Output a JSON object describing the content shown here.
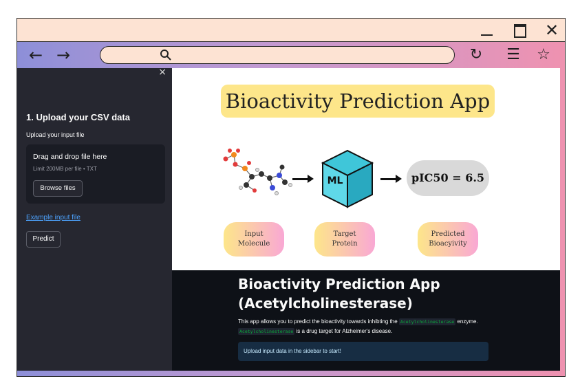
{
  "window": {
    "minimize": "−",
    "maximize": "",
    "close": "✕"
  },
  "toolbar": {
    "back": "←",
    "forward": "→",
    "reload": "↻",
    "menu": "☰",
    "bookmark": "☆"
  },
  "sidebar": {
    "close": "×",
    "heading": "1. Upload your CSV data",
    "upload_label": "Upload your input file",
    "dropzone_title": "Drag and drop file here",
    "dropzone_limit": "Limit 200MB per file • TXT",
    "browse_label": "Browse files",
    "example_link": "Example input file",
    "predict_label": "Predict"
  },
  "banner": {
    "title": "Bioactivity Prediction App",
    "model_label": "ML",
    "result": "pIC50 = 6.5",
    "pills": [
      {
        "line1": "Input",
        "line2": "Molecule"
      },
      {
        "line1": "Target",
        "line2": "Protein"
      },
      {
        "line1": "Predicted",
        "line2": "Bioacyivity"
      }
    ]
  },
  "main": {
    "title_line1": "Bioactivity Prediction App",
    "title_line2": "(Acetylcholinesterase)",
    "desc_prefix": "This app allows you to predict the bioactivity towards inhibting the",
    "desc_code": "Acetylcholinesterase",
    "desc_suffix": "enzyme.",
    "desc2_code": "Acetylcholinesterase",
    "desc2_suffix": "is a drug target for Alzheimer's disease.",
    "info": "Upload input data in the sidebar to start!"
  },
  "colors": {
    "sidebar_bg": "#262730",
    "main_bg": "#0e1117",
    "title_bg": "#fde68a",
    "cube_top": "#3fc6d9",
    "link": "#4da3ff",
    "info_bg": "#172d43"
  }
}
